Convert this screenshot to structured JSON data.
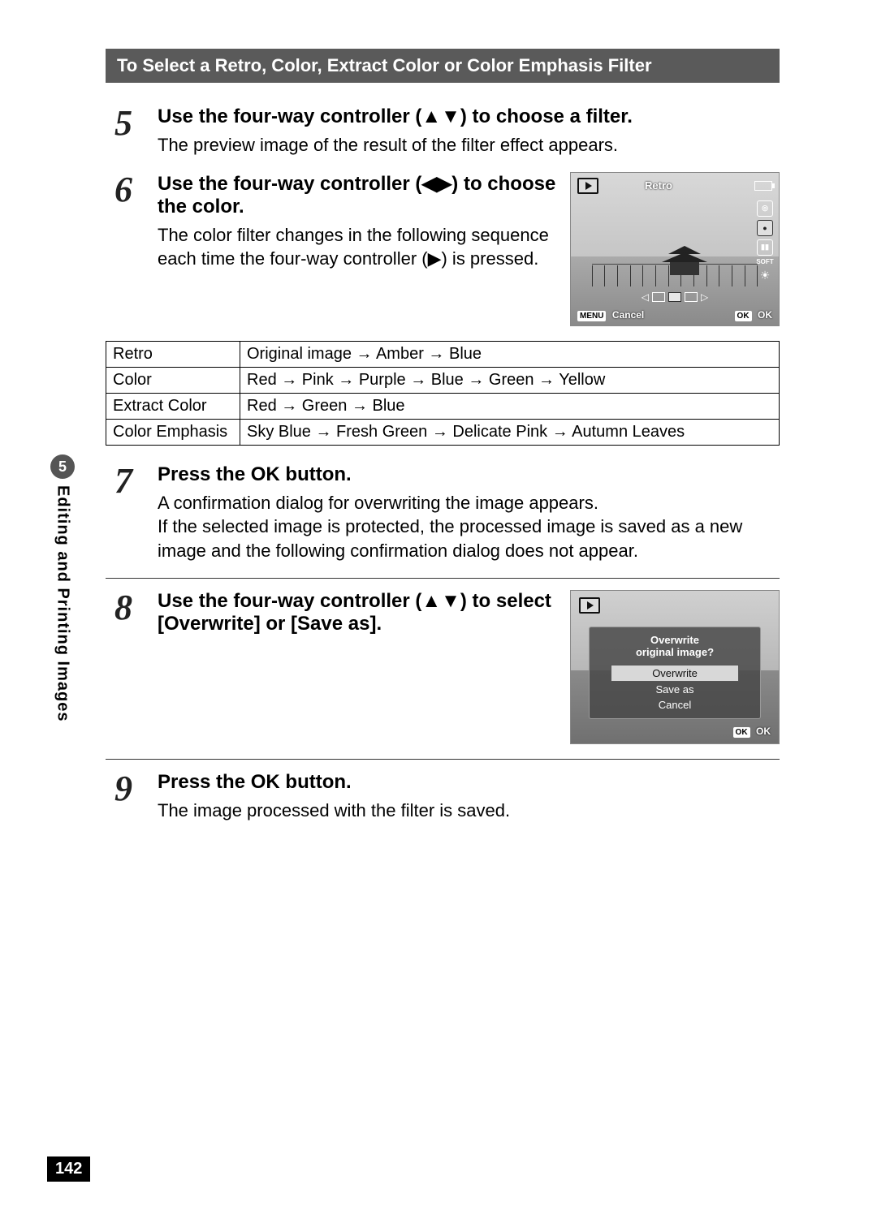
{
  "band_title": "To Select a Retro, Color, Extract Color or Color Emphasis Filter",
  "side": {
    "num": "5",
    "label": "Editing and Printing Images"
  },
  "page_number": "142",
  "steps": {
    "s5": {
      "num": "5",
      "head": "Use the four-way controller (▲▼) to choose a filter.",
      "desc": "The preview image of the result of the filter effect appears."
    },
    "s6": {
      "num": "6",
      "head": "Use the four-way controller (◀▶) to choose the color.",
      "desc": "The color filter changes in the following sequence each time the four-way controller (▶) is pressed."
    },
    "s7": {
      "num": "7",
      "head_pre": "Press the ",
      "head_ok": "OK",
      "head_post": " button.",
      "desc": "A confirmation dialog for overwriting the image appears.\nIf the selected image is protected, the processed image is saved as a new image and the following confirmation dialog does not appear."
    },
    "s8": {
      "num": "8",
      "head": "Use the four-way controller (▲▼) to select [Overwrite] or [Save as]."
    },
    "s9": {
      "num": "9",
      "head_pre": "Press the ",
      "head_ok": "OK",
      "head_post": " button.",
      "desc": "The image processed with the filter is saved."
    }
  },
  "table": {
    "rows": [
      {
        "k": "Retro",
        "v": "Original image → Amber → Blue"
      },
      {
        "k": "Color",
        "v": "Red → Pink → Purple → Blue → Green → Yellow"
      },
      {
        "k": "Extract Color",
        "v": "Red → Green → Blue"
      },
      {
        "k": "Color Emphasis",
        "v": "Sky Blue → Fresh Green → Delicate Pink → Autumn Leaves"
      }
    ]
  },
  "lcd1": {
    "title": "Retro",
    "soft_label": "SOFT",
    "menu_btn": "MENU",
    "menu_lbl": "Cancel",
    "ok_btn": "OK",
    "ok_lbl": "OK"
  },
  "lcd2": {
    "q1": "Overwrite",
    "q2": "original image?",
    "opt1": "Overwrite",
    "opt2": "Save as",
    "opt3": "Cancel",
    "ok_btn": "OK",
    "ok_lbl": "OK"
  }
}
